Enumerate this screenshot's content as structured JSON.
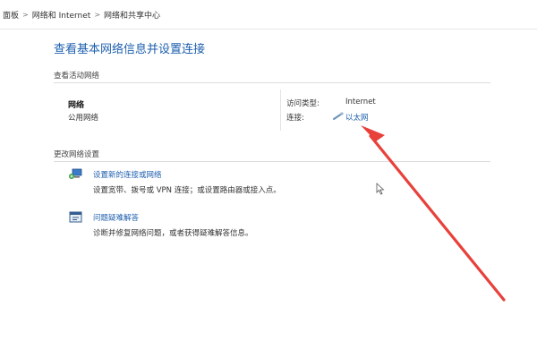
{
  "breadcrumb": {
    "items": [
      "面板",
      "网络和 Internet",
      "网络和共享中心"
    ],
    "separator": ">"
  },
  "page": {
    "title": "查看基本网络信息并设置连接"
  },
  "active_networks": {
    "label": "查看活动网络",
    "network_name": "网络",
    "network_category": "公用网络",
    "access_type_label": "访问类型:",
    "access_type_value": "Internet",
    "connections_label": "连接:",
    "connection_value": "以太网"
  },
  "change_settings": {
    "label": "更改网络设置",
    "tasks": [
      {
        "link": "设置新的连接或网络",
        "description": "设置宽带、拨号或 VPN 连接；或设置路由器或接入点。",
        "icon": "network-setup-icon"
      },
      {
        "link": "问题疑难解答",
        "description": "诊断并修复网络问题，或者获得疑难解答信息。",
        "icon": "troubleshoot-icon"
      }
    ]
  },
  "colors": {
    "link": "#1e5fae",
    "annotation_arrow": "#e8413b"
  }
}
